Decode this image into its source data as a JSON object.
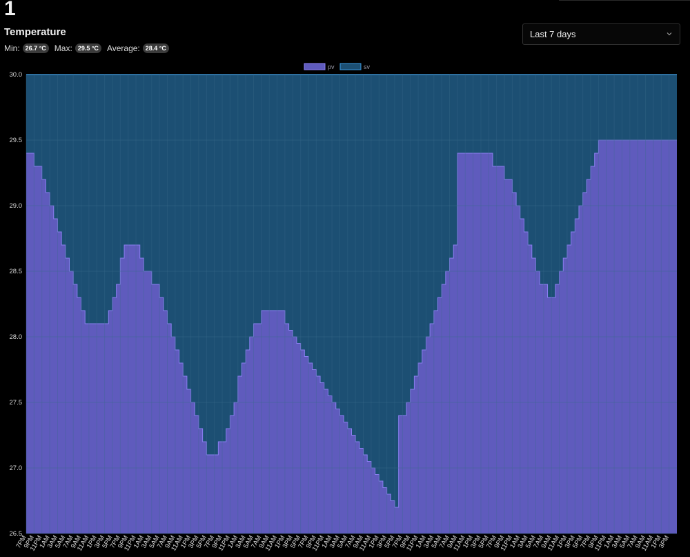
{
  "header": {
    "page_number": "1",
    "title": "Temperature"
  },
  "stats": {
    "min_label": "Min:",
    "min_value": "26.7 °C",
    "max_label": "Max:",
    "max_value": "29.5 °C",
    "avg_label": "Average:",
    "avg_value": "28.4 °C"
  },
  "range_select": {
    "value": "Last 7 days",
    "icon": "chevron-down-icon"
  },
  "colors": {
    "pv_fill": "#5f5bbd",
    "pv_line": "#8a7ff0",
    "sv_fill": "#1c4f73",
    "sv_line": "#3b9ae0",
    "grid": "#3a6a8a",
    "background": "#000000"
  },
  "chart_data": {
    "type": "area",
    "title": "",
    "xlabel": "",
    "ylabel": "",
    "ylim": [
      26.5,
      30.0
    ],
    "yticks": [
      "26.5",
      "27.0",
      "27.5",
      "28.0",
      "28.5",
      "29.0",
      "29.5",
      "30.0"
    ],
    "xtick_labels": [
      "7PM",
      "9PM",
      "11PM",
      "1AM",
      "3AM",
      "5AM",
      "7AM",
      "9AM",
      "11AM",
      "1PM",
      "3PM",
      "5PM",
      "7PM",
      "9PM",
      "11PM",
      "1AM",
      "3AM",
      "5AM",
      "7AM",
      "9AM",
      "11AM",
      "1PM",
      "3PM",
      "5PM",
      "7PM",
      "9PM",
      "11PM",
      "1AM",
      "3AM",
      "5AM",
      "7AM",
      "9AM",
      "11AM",
      "1PM",
      "3PM",
      "5PM",
      "7PM",
      "9PM",
      "11PM",
      "1AM",
      "3AM",
      "5AM",
      "7AM",
      "9AM",
      "11AM",
      "1PM",
      "3PM",
      "5PM",
      "7PM",
      "9PM",
      "11PM",
      "1AM",
      "3AM",
      "5AM",
      "7AM",
      "9AM",
      "11AM",
      "1PM",
      "3PM",
      "5PM",
      "7PM",
      "9PM",
      "11PM",
      "1AM",
      "3AM",
      "5AM",
      "7AM",
      "9AM",
      "11AM",
      "1PM",
      "3PM",
      "5PM",
      "7PM",
      "9PM",
      "11PM",
      "1AM",
      "3AM",
      "5AM",
      "7AM",
      "9AM",
      "11AM",
      "1PM",
      "3PM"
    ],
    "grid": true,
    "legend": "top-center",
    "x_hours": [
      0,
      1,
      2,
      3,
      4,
      5,
      6,
      7,
      8,
      9,
      10,
      11,
      12,
      13,
      14,
      15,
      16,
      17,
      18,
      19,
      20,
      21,
      22,
      23,
      24,
      25,
      26,
      27,
      28,
      29,
      30,
      31,
      32,
      33,
      34,
      35,
      36,
      37,
      38,
      39,
      40,
      41,
      42,
      43,
      44,
      45,
      46,
      47,
      48,
      49,
      50,
      51,
      52,
      53,
      54,
      55,
      56,
      57,
      58,
      59,
      60,
      61,
      62,
      63,
      64,
      65,
      66,
      67,
      68,
      69,
      70,
      71,
      72,
      73,
      74,
      75,
      76,
      77,
      78,
      79,
      80,
      81,
      82,
      83,
      84,
      85,
      86,
      87,
      88,
      89,
      90,
      91,
      92,
      93,
      94,
      95,
      96,
      97,
      98,
      99,
      100,
      101,
      102,
      103,
      104,
      105,
      106,
      107,
      108,
      109,
      110,
      111,
      112,
      113,
      114,
      115,
      116,
      117,
      118,
      119,
      120,
      121,
      122,
      123,
      124,
      125,
      126,
      127,
      128,
      129,
      130,
      131,
      132,
      133,
      134,
      135,
      136,
      137,
      138,
      139,
      140,
      141,
      142,
      143,
      144,
      145,
      146,
      147,
      148,
      149,
      150,
      151,
      152,
      153,
      154,
      155,
      156,
      157,
      158,
      159,
      160,
      161,
      162,
      163,
      164,
      165,
      166
    ],
    "series": [
      {
        "name": "pv",
        "values": [
          29.4,
          29.4,
          29.3,
          29.3,
          29.2,
          29.1,
          29.0,
          28.9,
          28.8,
          28.7,
          28.6,
          28.5,
          28.4,
          28.3,
          28.2,
          28.1,
          28.1,
          28.1,
          28.1,
          28.1,
          28.1,
          28.2,
          28.3,
          28.4,
          28.6,
          28.7,
          28.7,
          28.7,
          28.7,
          28.6,
          28.5,
          28.5,
          28.4,
          28.4,
          28.3,
          28.2,
          28.1,
          28.0,
          27.9,
          27.8,
          27.7,
          27.6,
          27.5,
          27.4,
          27.3,
          27.2,
          27.1,
          27.1,
          27.1,
          27.2,
          27.2,
          27.3,
          27.4,
          27.5,
          27.7,
          27.8,
          27.9,
          28.0,
          28.1,
          28.1,
          28.2,
          28.2,
          28.2,
          28.2,
          28.2,
          28.2,
          28.1,
          28.05,
          28.0,
          27.95,
          27.9,
          27.85,
          27.8,
          27.75,
          27.7,
          27.65,
          27.6,
          27.55,
          27.5,
          27.45,
          27.4,
          27.35,
          27.3,
          27.25,
          27.2,
          27.15,
          27.1,
          27.05,
          27.0,
          26.95,
          26.9,
          26.85,
          26.8,
          26.75,
          26.7,
          27.4,
          27.4,
          27.5,
          27.6,
          27.7,
          27.8,
          27.9,
          28.0,
          28.1,
          28.2,
          28.3,
          28.4,
          28.5,
          28.6,
          28.7,
          29.4,
          29.4,
          29.4,
          29.4,
          29.4,
          29.4,
          29.4,
          29.4,
          29.4,
          29.3,
          29.3,
          29.3,
          29.2,
          29.2,
          29.1,
          29.0,
          28.9,
          28.8,
          28.7,
          28.6,
          28.5,
          28.4,
          28.4,
          28.3,
          28.3,
          28.4,
          28.5,
          28.6,
          28.7,
          28.8,
          28.9,
          29.0,
          29.1,
          29.2,
          29.3,
          29.4,
          29.5,
          29.5,
          29.5
        ]
      },
      {
        "name": "sv",
        "values": [
          30.0,
          30.0
        ]
      }
    ]
  }
}
